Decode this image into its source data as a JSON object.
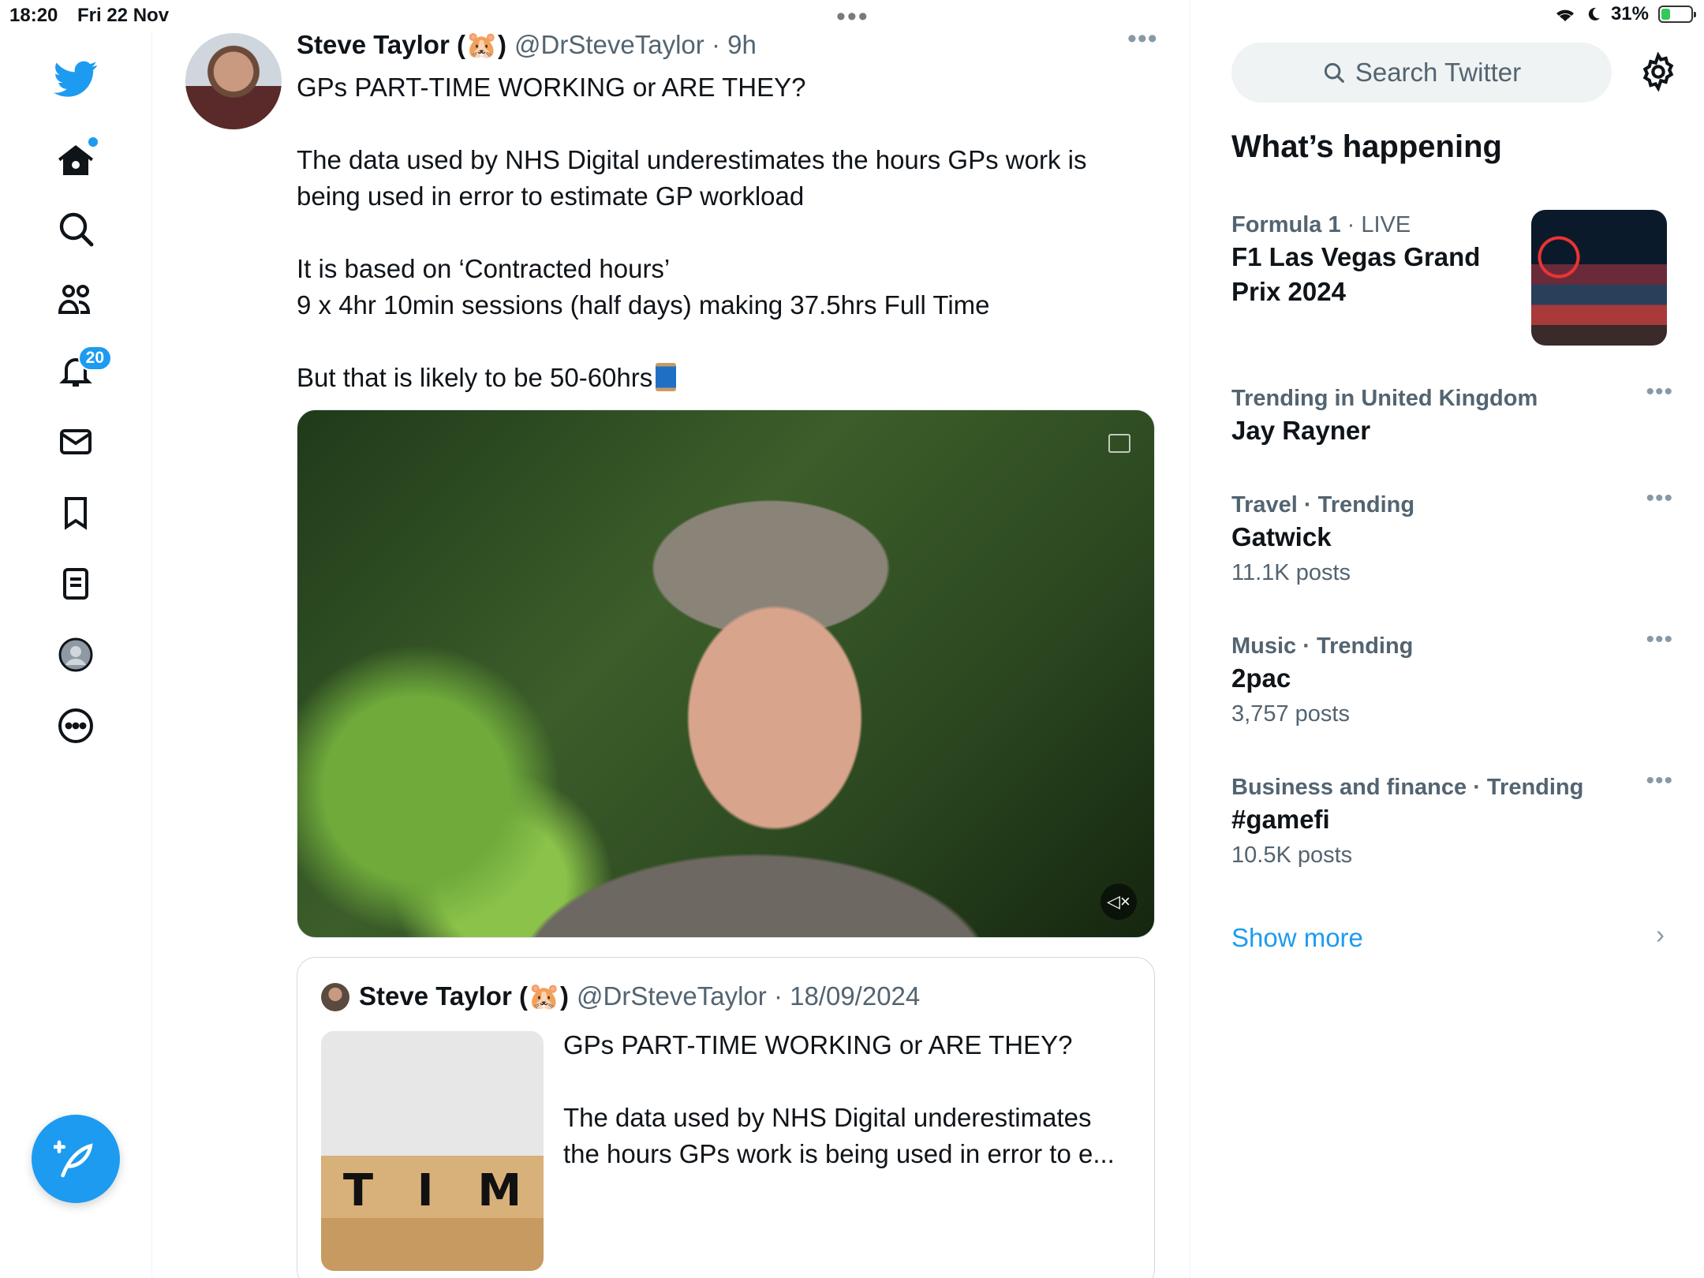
{
  "status_bar": {
    "time": "18:20",
    "date": "Fri 22 Nov",
    "battery": "31%",
    "battery_level": 0.31
  },
  "nav": {
    "items": [
      "home-icon",
      "search-icon",
      "communities-icon",
      "notifications-icon",
      "messages-icon",
      "bookmarks-icon",
      "lists-icon",
      "profile-icon",
      "more-icon"
    ],
    "notifications_count": "20"
  },
  "tweet": {
    "author_name": "Steve Taylor (🐹)",
    "author_handle": "@DrSteveTaylor · 9h",
    "paragraphs": [
      "GPs PART-TIME WORKING or ARE THEY?",
      "The data used by NHS Digital underestimates the hours GPs work is\nbeing used in error to estimate GP workload",
      "It is based on ‘Contracted hours’\n9 x 4hr 10min sessions (half days) making 37.5hrs Full Time",
      "But that is likely to be 50-60hrs"
    ]
  },
  "quote": {
    "author_name": "Steve Taylor (🐹)",
    "author_handle": "@DrSteveTaylor · 18/09/2024",
    "paragraphs": [
      "GPs PART-TIME WORKING or ARE THEY?",
      "The data used by NHS Digital underestimates\nthe hours GPs work is being used in error to e..."
    ],
    "thumb_letters": [
      "T",
      "I",
      "M"
    ]
  },
  "sidebar": {
    "search_placeholder": "Search Twitter",
    "title": "What’s happening",
    "trends": [
      {
        "category": "Formula 1",
        "context": "· LIVE",
        "name": "F1 Las Vegas Grand\nPrix 2024",
        "count": ""
      },
      {
        "category": "Trending in United Kingdom",
        "context": "",
        "name": "Jay Rayner",
        "count": ""
      },
      {
        "category": "Travel · Trending",
        "context": "",
        "name": "Gatwick",
        "count": "11.1K posts"
      },
      {
        "category": "Music · Trending",
        "context": "",
        "name": "2pac",
        "count": "3,757 posts"
      },
      {
        "category": "Business and finance · Trending",
        "context": "",
        "name": "#gamefi",
        "count": "10.5K posts"
      }
    ],
    "show_more": "Show more"
  },
  "colors": {
    "accent": "#1d9bf0",
    "text": "#0f1419",
    "secondary": "#536471"
  }
}
